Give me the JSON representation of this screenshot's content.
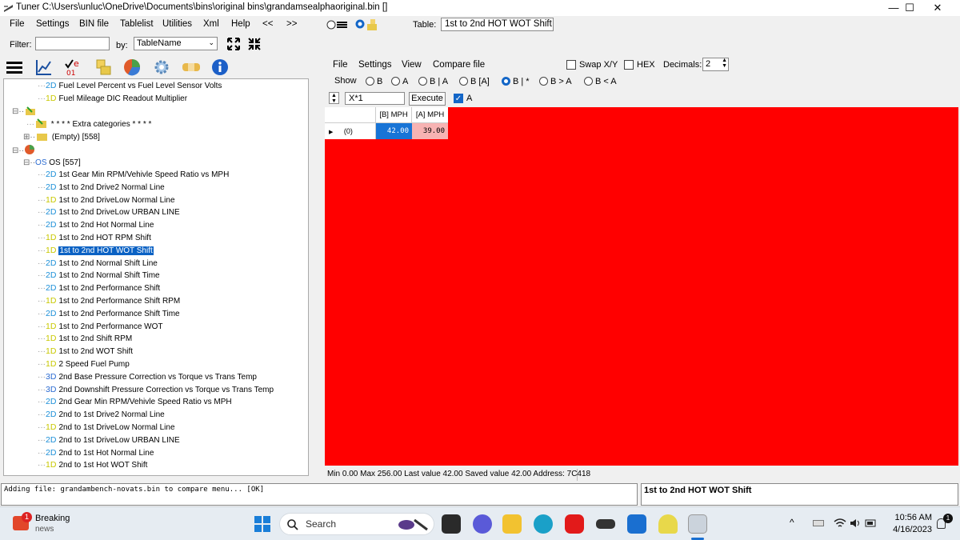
{
  "window": {
    "title": "Tuner C:\\Users\\unluc\\OneDrive\\Documents\\bins\\original bins\\grandamsealphaoriginal.bin []",
    "minimize": "—",
    "maximize": "☐",
    "close": "✕"
  },
  "menu": [
    "File",
    "Settings",
    "BIN file",
    "Tablelist",
    "Utilities",
    "Xml",
    "Help",
    "<<",
    ">>"
  ],
  "table_label": "Table:",
  "table_name": "1st to 2nd HOT WOT Shift",
  "filter": {
    "label": "Filter:",
    "value": "",
    "by_label": "by:",
    "by_value": "TableName"
  },
  "sub_menu": [
    "File",
    "Settings",
    "View",
    "Compare file"
  ],
  "swap_xy": "Swap X/Y",
  "hex": "HEX",
  "decimals": {
    "label": "Decimals:",
    "value": "2"
  },
  "show": {
    "label": "Show",
    "options": [
      "B",
      "A",
      "B | A",
      "B [A]",
      "B | *",
      "B > A",
      "B < A"
    ],
    "selected": 4
  },
  "formula": {
    "value": "X*1",
    "execute": "Execute",
    "a_label": "A"
  },
  "grid": {
    "columns": [
      "[B] MPH",
      "[A] MPH"
    ],
    "row_header": "(0)",
    "b_value": "42.00",
    "a_value": "39.00",
    "colors": {
      "b_cell": "#1874d6",
      "a_cell": "#f7b3b3"
    }
  },
  "status_bar": "Min 0.00 Max 256.00 Last value 42.00 Saved value 42.00 Address: 7C418",
  "log": "Adding file: grandambench-novats.bin to compare menu... [OK]",
  "description": "1st to 2nd HOT WOT Shift",
  "tree": {
    "top_items": [
      {
        "dim": "2D",
        "label": "Fuel Level Percent vs Fuel Level Sensor Volts"
      },
      {
        "dim": "1D",
        "label": "Fuel Mileage DIC Readout Multiplier"
      }
    ],
    "extra": "* * * * Extra categories * * * *",
    "empty": "(Empty) [558]",
    "os_prefix": "OS",
    "os_label": "OS [557]",
    "os_items": [
      {
        "dim": "2D",
        "label": "1st Gear Min RPM/Vehivle Speed Ratio vs MPH"
      },
      {
        "dim": "2D",
        "label": "1st to 2nd Drive2 Normal Line"
      },
      {
        "dim": "1D",
        "label": "1st to 2nd DriveLow Normal Line"
      },
      {
        "dim": "2D",
        "label": "1st to 2nd DriveLow URBAN LINE"
      },
      {
        "dim": "2D",
        "label": "1st to 2nd Hot Normal Line"
      },
      {
        "dim": "1D",
        "label": "1st to 2nd HOT RPM Shift"
      },
      {
        "dim": "1D",
        "label": "1st to 2nd HOT WOT Shift",
        "selected": true
      },
      {
        "dim": "2D",
        "label": "1st to 2nd Normal Shift Line"
      },
      {
        "dim": "2D",
        "label": "1st to 2nd Normal Shift Time"
      },
      {
        "dim": "2D",
        "label": "1st to 2nd Performance Shift"
      },
      {
        "dim": "1D",
        "label": "1st to 2nd Performance Shift RPM"
      },
      {
        "dim": "2D",
        "label": "1st to 2nd Performance Shift Time"
      },
      {
        "dim": "1D",
        "label": "1st to 2nd Performance WOT"
      },
      {
        "dim": "1D",
        "label": "1st to 2nd Shift RPM"
      },
      {
        "dim": "1D",
        "label": "1st to 2nd WOT Shift"
      },
      {
        "dim": "1D",
        "label": "2 Speed Fuel Pump"
      },
      {
        "dim": "3D",
        "label": "2nd Base Pressure Correction vs Torque vs Trans Temp"
      },
      {
        "dim": "3D",
        "label": "2nd Downshift Pressure Correction vs Torque vs Trans Temp"
      },
      {
        "dim": "2D",
        "label": "2nd Gear Min RPM/Vehivle Speed Ratio vs MPH"
      },
      {
        "dim": "2D",
        "label": "2nd to 1st Drive2 Normal Line"
      },
      {
        "dim": "1D",
        "label": "2nd to 1st DriveLow Normal Line"
      },
      {
        "dim": "2D",
        "label": "2nd to 1st DriveLow URBAN LINE"
      },
      {
        "dim": "2D",
        "label": "2nd to 1st Hot Normal Line"
      },
      {
        "dim": "1D",
        "label": "2nd to 1st Hot WOT Shift"
      }
    ]
  },
  "taskbar": {
    "news_badge": "1",
    "news_title": "Breaking",
    "news_sub": "news",
    "search_placeholder": "Search",
    "time": "10:56 AM",
    "date": "4/16/2023",
    "notif_badge": "1",
    "chevron": "^"
  }
}
